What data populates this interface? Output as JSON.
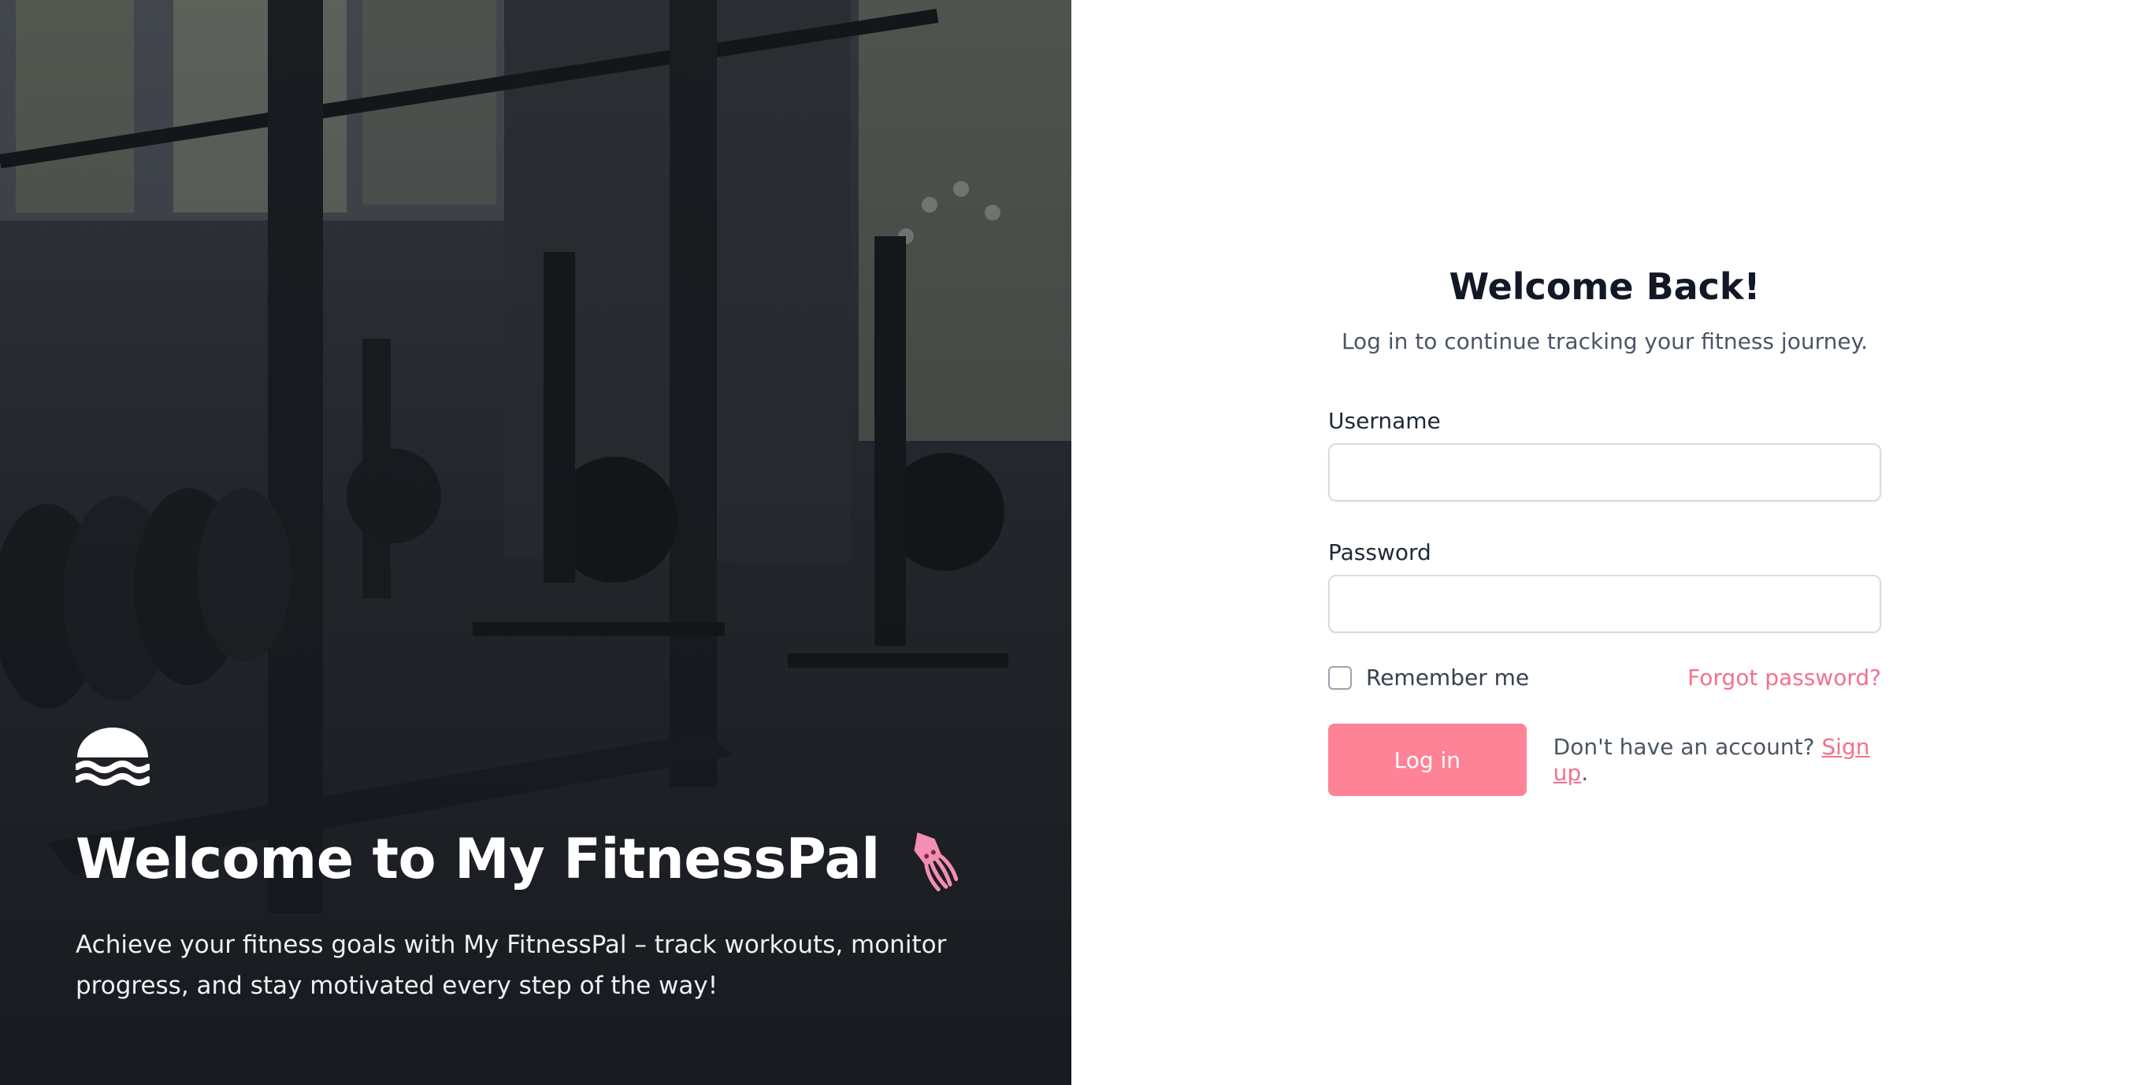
{
  "hero": {
    "title": "Welcome to My FitnessPal",
    "description": "Achieve your fitness goals with My FitnessPal – track workouts, monitor progress, and stay motivated every step of the way!",
    "accent_color": "#f06292",
    "logo_icon": "waves-logo-icon",
    "emoji_icon": "squid-icon"
  },
  "login": {
    "title": "Welcome Back!",
    "subtitle": "Log in to continue tracking your fitness journey.",
    "username_label": "Username",
    "username_value": "",
    "password_label": "Password",
    "password_value": "",
    "remember_label": "Remember me",
    "remember_checked": false,
    "forgot_label": "Forgot password?",
    "login_button": "Log in",
    "signup_prompt": "Don't have an account?",
    "signup_link": "Sign up",
    "signup_suffix": ".",
    "button_color": "#fe8397",
    "link_color": "#f4718c"
  }
}
